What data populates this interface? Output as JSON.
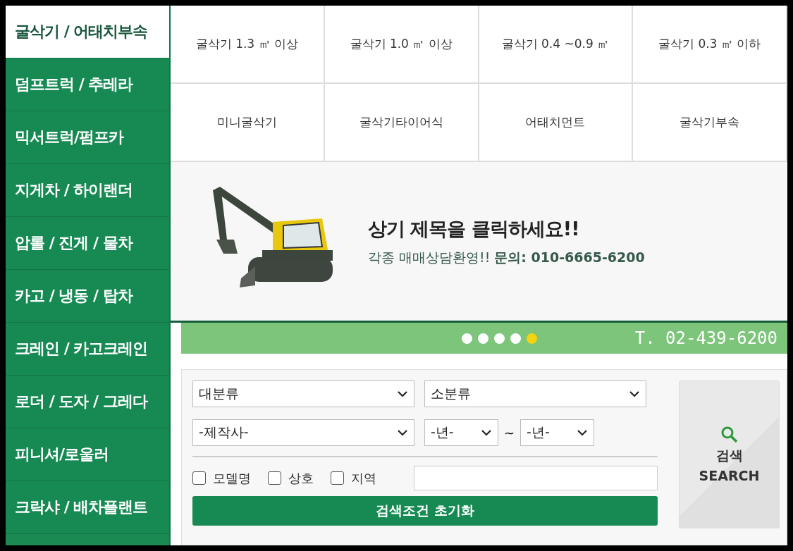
{
  "sidebar": {
    "items": [
      {
        "label": "굴삭기 / 어태치부속",
        "selected": true
      },
      {
        "label": "덤프트럭 / 추레라",
        "selected": false
      },
      {
        "label": "믹서트럭/펌프카",
        "selected": false
      },
      {
        "label": "지게차 / 하이랜더",
        "selected": false
      },
      {
        "label": "압롤 / 진게 / 물차",
        "selected": false
      },
      {
        "label": "카고 / 냉동 / 탑차",
        "selected": false
      },
      {
        "label": "크레인 / 카고크레인",
        "selected": false
      },
      {
        "label": "로더 / 도자 / 그레다",
        "selected": false
      },
      {
        "label": "피니셔/로울러",
        "selected": false
      },
      {
        "label": "크락샤 / 배차플랜트",
        "selected": false
      }
    ]
  },
  "subcategories": [
    "굴삭기 1.3 ㎥ 이상",
    "굴삭기 1.0 ㎥ 이상",
    "굴삭기 0.4 ~0.9 ㎥",
    "굴삭기 0.3 ㎥ 이하",
    "미니굴삭기",
    "굴삭기타이어식",
    "어태치먼트",
    "굴삭기부속"
  ],
  "banner": {
    "title": "상기 제목을 **클릭**하세요!!",
    "subtitle": "각종 매매상담환영!! **문의: 010-6665-6200**"
  },
  "slider": {
    "dots": [
      {
        "selected": false
      },
      {
        "selected": false
      },
      {
        "selected": false
      },
      {
        "selected": false
      },
      {
        "selected": true
      }
    ],
    "phone": "T. 02-439-6200"
  },
  "search": {
    "category": "대분류",
    "subcategory": "소분류",
    "maker": "-제작사-",
    "year_from": "-년-",
    "range_sep": "~",
    "year_to": "-년-",
    "checkboxes": [
      {
        "label": "모델명",
        "checked": false
      },
      {
        "label": "상호",
        "checked": false
      },
      {
        "label": "지역",
        "checked": false
      }
    ],
    "reset": "검색조건 초기화",
    "button": {
      "label": "검색",
      "sublabel": "SEARCH"
    }
  }
}
